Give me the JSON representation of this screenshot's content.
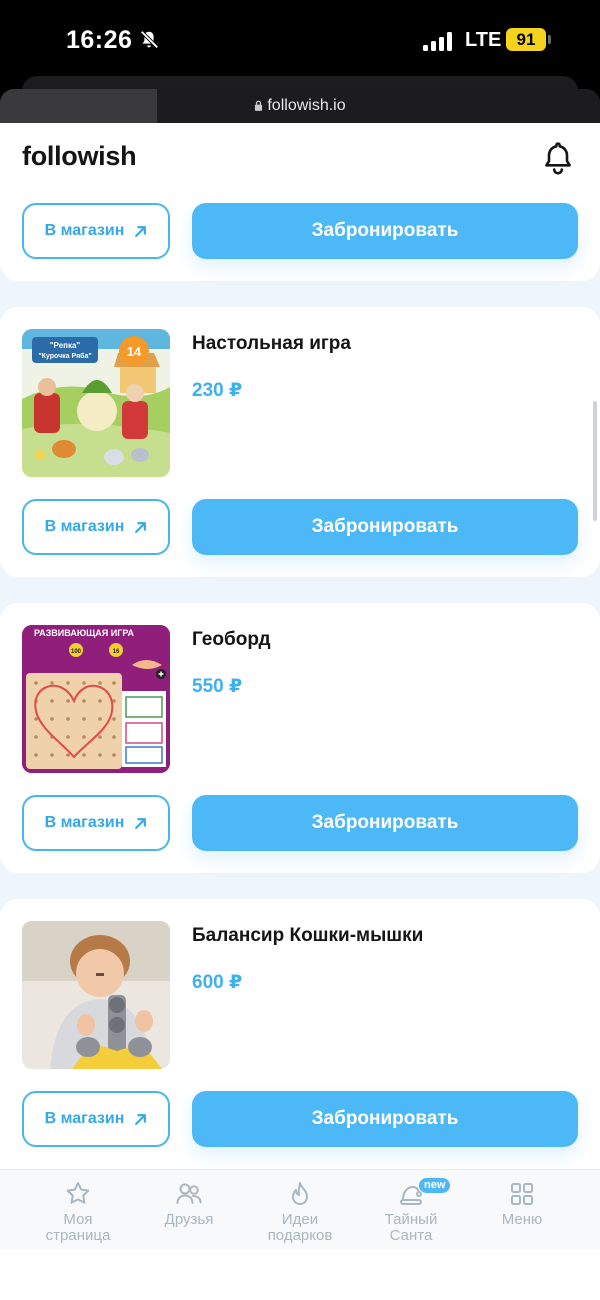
{
  "status_bar": {
    "time": "16:26",
    "network": "LTE",
    "battery": "91"
  },
  "browser": {
    "url": "followish.io"
  },
  "header": {
    "logo": "followish"
  },
  "top_card": {
    "shop_label": "В магазин",
    "reserve_label": "Забронировать"
  },
  "products": [
    {
      "title": "Настольная игра",
      "price": "230 ₽",
      "shop_label": "В магазин",
      "reserve_label": "Забронировать",
      "image_text": [
        "\"Репка\"",
        "\"Курочка Ряба\"",
        "14"
      ]
    },
    {
      "title": "Геоборд",
      "price": "550 ₽",
      "shop_label": "В магазин",
      "reserve_label": "Забронировать",
      "image_text": [
        "РАЗВИВАЮЩАЯ ИГРА",
        "100",
        "16"
      ]
    },
    {
      "title": "Балансир Кошки-мышки",
      "price": "600 ₽",
      "shop_label": "В магазин",
      "reserve_label": "Забронировать"
    }
  ],
  "nav": {
    "items": [
      {
        "label": "Моя\nстраница",
        "icon": "star-icon"
      },
      {
        "label": "Друзья",
        "icon": "friends-icon"
      },
      {
        "label": "Идеи\nподарков",
        "icon": "fire-icon"
      },
      {
        "label": "Тайный\nСанта",
        "icon": "santa-hat-icon",
        "badge": "new"
      },
      {
        "label": "Меню",
        "icon": "grid-icon"
      }
    ]
  },
  "colors": {
    "accent": "#4cb9f6",
    "price": "#3fb0ee",
    "page_bg": "#eef5fb",
    "nav_inactive": "#a9b7c3"
  }
}
